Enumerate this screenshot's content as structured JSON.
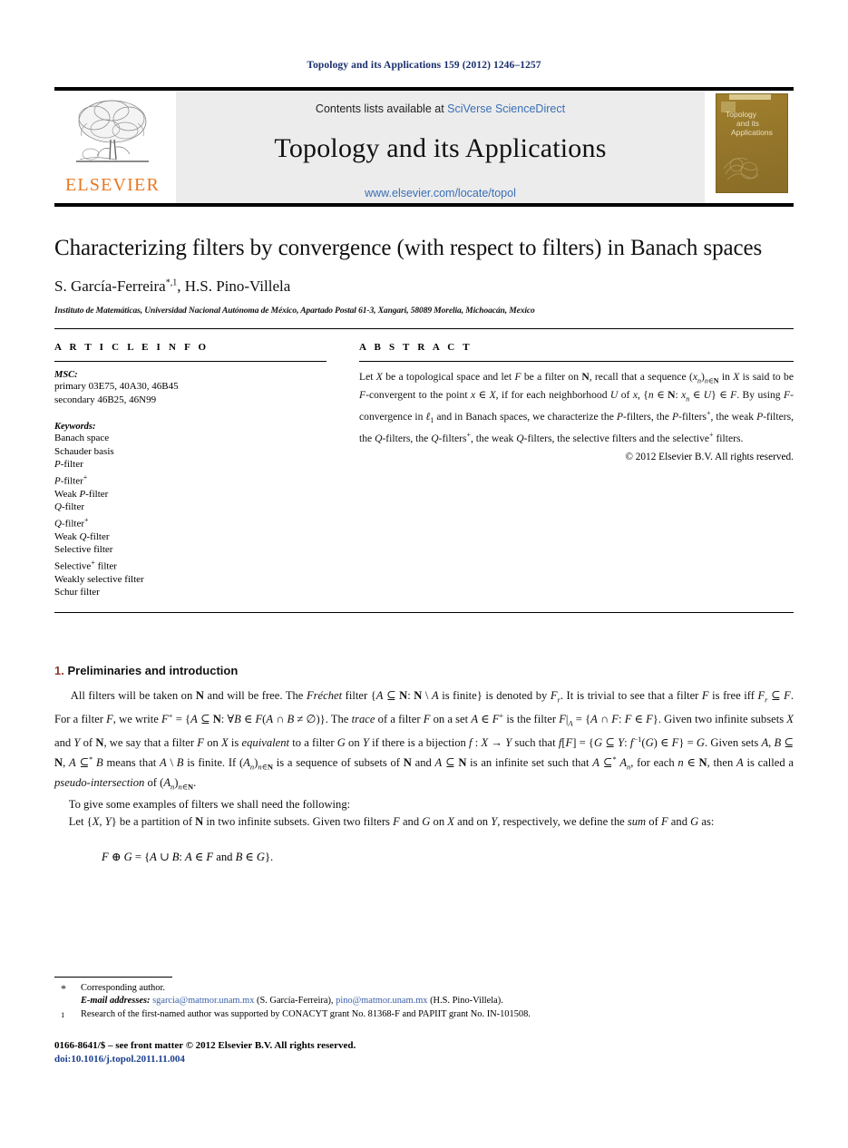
{
  "running_head": "Topology and its Applications 159 (2012) 1246–1257",
  "masthead": {
    "contents_prefix": "Contents lists available at ",
    "contents_link": "SciVerse ScienceDirect",
    "journal_title": "Topology and its Applications",
    "journal_url": "www.elsevier.com/locate/topol",
    "publisher_name": "ELSEVIER",
    "publisher_color": "#E87722",
    "cover_title_lines": [
      "Topology",
      "and its",
      "Applications"
    ],
    "cover_color": "#9b7d2e"
  },
  "article": {
    "title": "Characterizing filters by convergence (with respect to filters) in Banach spaces",
    "authors": "S. García-Ferreira*,1, H.S. Pino-Villela",
    "affiliation": "Instituto de Matemáticas, Universidad Nacional Autónoma de México, Apartado Postal 61-3, Xangari, 58089 Morelia, Michoacán, Mexico"
  },
  "info": {
    "heading": "A R T I C L E    I N F O",
    "msc_label": "MSC:",
    "msc_lines": [
      "primary 03E75, 40A30, 46B45",
      "secondary 46B25, 46N99"
    ],
    "keywords_label": "Keywords:",
    "keywords": [
      "Banach space",
      "Schauder basis",
      "P-filter",
      "P-filter+",
      "Weak P-filter",
      "Q-filter",
      "Q-filter+",
      "Weak Q-filter",
      "Selective filter",
      "Selective+ filter",
      "Weakly selective filter",
      "Schur filter"
    ]
  },
  "abstract": {
    "heading": "A B S T R A C T",
    "text": "Let X be a topological space and let F be a filter on N, recall that a sequence (xn)n∈N in X is said to be F-convergent to the point x ∈ X, if for each neighborhood U of x, {n ∈ N: xn ∈ U} ∈ F. By using F-convergence in ℓ1 and in Banach spaces, we characterize the P-filters, the P-filters+, the weak P-filters, the Q-filters, the Q-filters+, the weak Q-filters, the selective filters and the selective+ filters.",
    "copyright": "© 2012 Elsevier B.V. All rights reserved."
  },
  "body": {
    "section_number": "1.",
    "section_title": "Preliminaries and introduction",
    "paragraph_1": "All filters will be taken on N and will be free. The Fréchet filter {A ⊆ N: N \\ A is finite} is denoted by Fr. It is trivial to see that a filter F is free iff Fr ⊆ F. For a filter F, we write F+ = {A ⊆ N: ∀B ∈ F(A ∩ B ≠ ∅)}. The trace of a filter F on a set A ∈ F+ is the filter F|A = {A ∩ F: F ∈ F}. Given two infinite subsets X and Y of N, we say that a filter F on X is equivalent to a filter G on Y if there is a bijection f : X → Y such that f[F] = {G ⊆ Y: f−1(G) ∈ F} = G. Given sets A, B ⊆ N, A ⊆* B means that A \\ B is finite. If (An)n∈N is a sequence of subsets of N and A ⊆ N is an infinite set such that A ⊆* An, for each n ∈ N, then A is called a pseudo-intersection of (An)n∈N.",
    "paragraph_2": "To give some examples of filters we shall need the following:",
    "paragraph_3": "Let {X, Y} be a partition of N in two infinite subsets. Given two filters F and G on X and on Y, respectively, we define the sum of F and G as:",
    "display_equation": "F ⊕ G = {A ∪ B: A ∈ F and B ∈ G}."
  },
  "footnotes": {
    "star_mark": "*",
    "star_text": "Corresponding author.",
    "email_label": "E-mail addresses:",
    "email_1": "sgarcia@matmor.unam.mx",
    "email_1_owner": "(S. García-Ferreira),",
    "email_2": "pino@matmor.unam.mx",
    "email_2_owner": "(H.S. Pino-Villela).",
    "one_mark": "1",
    "one_text": "Research of the first-named author was supported by CONACYT grant No. 81368-F and PAPIIT grant No. IN-101508."
  },
  "imprint": {
    "issn_line": "0166-8641/$ – see front matter © 2012 Elsevier B.V. All rights reserved.",
    "doi_line": "doi:10.1016/j.topol.2011.11.004"
  }
}
